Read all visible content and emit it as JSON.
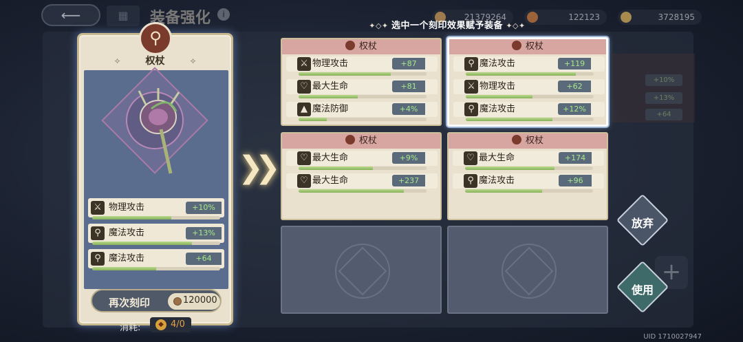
{
  "top_bar": {
    "title": "装备强化",
    "currencies": [
      {
        "icon": "gem-icon",
        "value": "21379264",
        "color": "#c99a5a"
      },
      {
        "icon": "stone-icon",
        "value": "122123",
        "color": "#c87a3e"
      },
      {
        "icon": "gold-icon",
        "value": "3728195",
        "color": "#d8b05a"
      }
    ]
  },
  "header": {
    "instruction": "选中一个刻印效果赋予装备"
  },
  "equipment": {
    "name": "权杖",
    "stats": [
      {
        "icon": "sword-icon",
        "name": "物理攻击",
        "value": "+10%",
        "fill": 0.62
      },
      {
        "icon": "wand-icon",
        "name": "魔法攻击",
        "value": "+13%",
        "fill": 0.78
      },
      {
        "icon": "wand-icon",
        "name": "魔法攻击",
        "value": "+64",
        "fill": 0.5
      }
    ],
    "reengrave_label": "再次刻印",
    "reengrave_cost": "120000",
    "consume_label": "消耗:",
    "consume_value": "4/0"
  },
  "options": [
    {
      "title": "权杖",
      "selected": false,
      "stats": [
        {
          "icon": "sword-icon",
          "name": "物理攻击",
          "value": "+87",
          "fill": 0.72
        },
        {
          "icon": "heart-icon",
          "name": "最大生命",
          "value": "+81",
          "fill": 0.46
        },
        {
          "icon": "hat-icon",
          "name": "魔法防御",
          "value": "+4%",
          "fill": 0.22
        }
      ]
    },
    {
      "title": "权杖",
      "selected": true,
      "stats": [
        {
          "icon": "wand-icon",
          "name": "魔法攻击",
          "value": "+119",
          "fill": 0.86
        },
        {
          "icon": "sword-icon",
          "name": "物理攻击",
          "value": "+62",
          "fill": 0.52
        },
        {
          "icon": "wand-icon",
          "name": "魔法攻击",
          "value": "+12%",
          "fill": 0.68
        }
      ]
    },
    {
      "title": "权杖",
      "selected": false,
      "stats": [
        {
          "icon": "heart-icon",
          "name": "最大生命",
          "value": "+9%",
          "fill": 0.58
        },
        {
          "icon": "heart-icon",
          "name": "最大生命",
          "value": "+237",
          "fill": 0.82
        }
      ]
    },
    {
      "title": "权杖",
      "selected": false,
      "stats": [
        {
          "icon": "heart-icon",
          "name": "最大生命",
          "value": "+174",
          "fill": 0.7
        },
        {
          "icon": "wand-icon",
          "name": "魔法攻击",
          "value": "+96",
          "fill": 0.6
        }
      ]
    }
  ],
  "actions": {
    "abandon_label": "放弃",
    "use_label": "使用"
  },
  "background_badges": [
    "+10%",
    "+13%",
    "+64"
  ],
  "uid": "UID 1710027947"
}
